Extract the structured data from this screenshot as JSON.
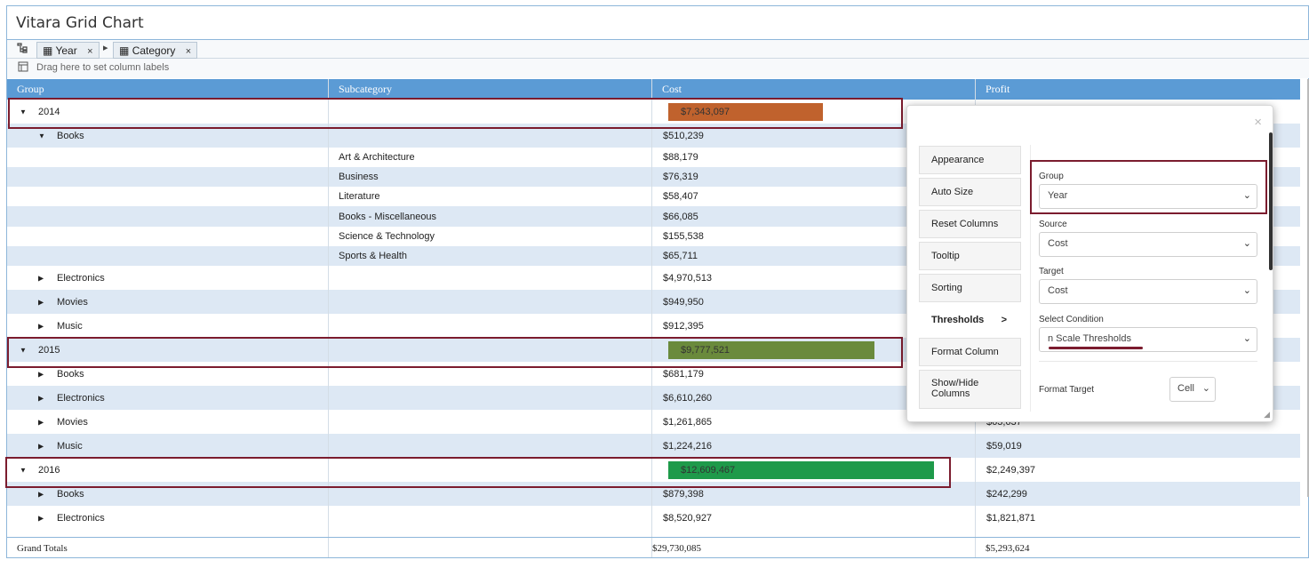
{
  "app": {
    "title": "Vitara Grid Chart"
  },
  "toolbar": {
    "tree_icon": "tree-icon",
    "chips": [
      {
        "label": "Year",
        "close": "×"
      },
      {
        "label": "Category",
        "close": "×"
      }
    ],
    "arrow": "▸",
    "drag_text": "Drag here to set column labels",
    "drag_icon": "column-labels-icon"
  },
  "columns": [
    "Group",
    "Subcategory",
    "Cost",
    "Profit"
  ],
  "rows": [
    {
      "group": "2014",
      "sub": "",
      "cost": "$7,343,097",
      "profit": "",
      "level": 0,
      "expanded": true,
      "bar_fraction": 0.583,
      "bar_color": "#c0622d"
    },
    {
      "group": "Books",
      "sub": "",
      "cost": "$510,239",
      "profit": "",
      "level": 1,
      "expanded": true
    },
    {
      "group": "",
      "sub": "Art & Architecture",
      "cost": "$88,179",
      "profit": "",
      "level": 2
    },
    {
      "group": "",
      "sub": "Business",
      "cost": "$76,319",
      "profit": "",
      "level": 2
    },
    {
      "group": "",
      "sub": "Literature",
      "cost": "$58,407",
      "profit": "",
      "level": 2
    },
    {
      "group": "",
      "sub": "Books - Miscellaneous",
      "cost": "$66,085",
      "profit": "",
      "level": 2
    },
    {
      "group": "",
      "sub": "Science & Technology",
      "cost": "$155,538",
      "profit": "",
      "level": 2
    },
    {
      "group": "",
      "sub": "Sports & Health",
      "cost": "$65,711",
      "profit": "",
      "level": 2
    },
    {
      "group": "Electronics",
      "sub": "",
      "cost": "$4,970,513",
      "profit": "",
      "level": 1,
      "expanded": false
    },
    {
      "group": "Movies",
      "sub": "",
      "cost": "$949,950",
      "profit": "",
      "level": 1,
      "expanded": false
    },
    {
      "group": "Music",
      "sub": "",
      "cost": "$912,395",
      "profit": "",
      "level": 1,
      "expanded": false
    },
    {
      "group": "2015",
      "sub": "",
      "cost": "$9,777,521",
      "profit": "",
      "level": 0,
      "expanded": true,
      "bar_fraction": 0.776,
      "bar_color": "#6a8a3c"
    },
    {
      "group": "Books",
      "sub": "",
      "cost": "$681,179",
      "profit": "",
      "level": 1,
      "expanded": false
    },
    {
      "group": "Electronics",
      "sub": "",
      "cost": "$6,610,260",
      "profit": "",
      "level": 1,
      "expanded": false
    },
    {
      "group": "Movies",
      "sub": "",
      "cost": "$1,261,865",
      "profit": "$63,637",
      "level": 1,
      "expanded": false
    },
    {
      "group": "Music",
      "sub": "",
      "cost": "$1,224,216",
      "profit": "$59,019",
      "level": 1,
      "expanded": false
    },
    {
      "group": "2016",
      "sub": "",
      "cost": "$12,609,467",
      "profit": "$2,249,397",
      "level": 0,
      "expanded": true,
      "bar_fraction": 1.0,
      "bar_color": "#1e9a4a"
    },
    {
      "group": "Books",
      "sub": "",
      "cost": "$879,398",
      "profit": "$242,299",
      "level": 1,
      "expanded": false
    },
    {
      "group": "Electronics",
      "sub": "",
      "cost": "$8,520,927",
      "profit": "$1,821,871",
      "level": 1,
      "expanded": false
    }
  ],
  "grand_totals": {
    "label": "Grand Totals",
    "cost": "$29,730,085",
    "profit": "$5,293,624"
  },
  "popup": {
    "close": "×",
    "menu": [
      "Appearance",
      "Auto Size",
      "Reset Columns",
      "Tooltip",
      "Sorting",
      "Thresholds",
      "Format Column",
      "Show/Hide Columns"
    ],
    "active_menu": "Thresholds",
    "active_arrow": ">",
    "fields": {
      "group_label": "Group",
      "group_value": "Year",
      "source_label": "Source",
      "source_value": "Cost",
      "target_label": "Target",
      "target_value": "Cost",
      "condition_label": "Select Condition",
      "condition_value": "n Scale Thresholds",
      "format_target_label": "Format Target",
      "format_target_value": "Cell"
    },
    "chevron": "⌄"
  },
  "colors": {
    "header": "#5b9bd5",
    "alt_row": "#dde8f4",
    "highlight": "#7b1c2e"
  }
}
